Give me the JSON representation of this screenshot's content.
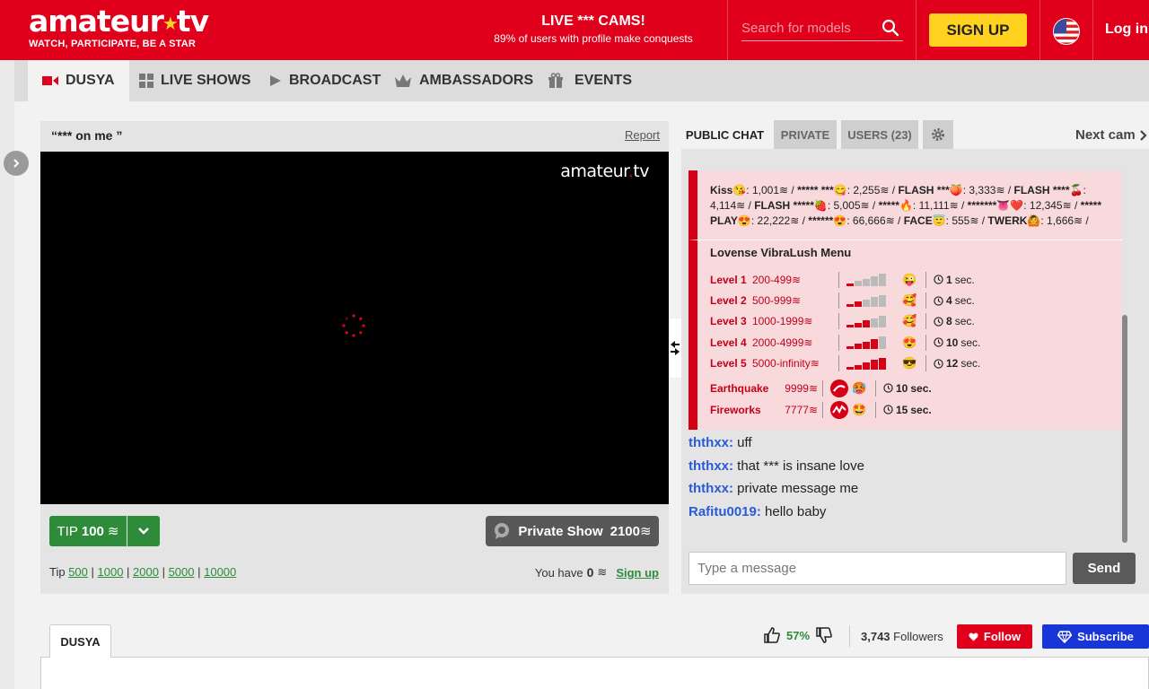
{
  "header": {
    "logo_word_left": "amateur",
    "logo_word_right": "tv",
    "tagline": "WATCH, PARTICIPATE, BE A STAR",
    "promo_title": "LIVE *** CAMS!",
    "promo_subtitle": "89% of users with profile make conquests",
    "search_placeholder": "Search for models",
    "signup_label": "SIGN UP",
    "login_label": "Log in",
    "brand_color": "#e0001b",
    "accent_color": "#ffd21f"
  },
  "nav": {
    "items": [
      {
        "label": "DUSYA",
        "icon": "camera-icon"
      },
      {
        "label": "LIVE SHOWS",
        "icon": "grid-icon"
      },
      {
        "label": "BROADCAST",
        "icon": "play-icon"
      },
      {
        "label": "AMBASSADORS",
        "icon": "crown-icon"
      },
      {
        "label": "EVENTS",
        "icon": "gift-icon"
      }
    ]
  },
  "player": {
    "title": "“*** on me ”",
    "report_label": "Report",
    "video_logo_left": "amateur",
    "video_logo_right": "tv",
    "tip_label": "TIP",
    "tip_amount": "100",
    "private_label": "Private Show",
    "private_price": "2100",
    "tip_prefix": "Tip",
    "tip_presets": [
      "500",
      "1000",
      "2000",
      "5000",
      "10000"
    ],
    "balance_label": "You have",
    "balance_value": "0",
    "balance_signup": "Sign up"
  },
  "chat": {
    "tabs": {
      "public": "PUBLIC CHAT",
      "private": "PRIVATE",
      "users": "USERS (23)"
    },
    "next_cam": "Next cam",
    "tip_menu": [
      {
        "name": "Kiss😘",
        "price": "1,001"
      },
      {
        "name": "***** ***😋",
        "price": "2,255"
      },
      {
        "name": "FLASH ***🍑",
        "price": "3,333"
      },
      {
        "name": "FLASH ****🍒",
        "price": "4,114"
      },
      {
        "name": "FLASH *****🍓",
        "price": "5,005"
      },
      {
        "name": "*****🔥",
        "price": "11,111"
      },
      {
        "name": "*******👅❤️",
        "price": "12,345"
      },
      {
        "name": "***** PLAY😍",
        "price": "22,222"
      },
      {
        "name": "******😍",
        "price": "66,666"
      },
      {
        "name": "FACE😇",
        "price": "555"
      },
      {
        "name": "TWERK🙆",
        "price": "1,666"
      }
    ],
    "lovense": {
      "title": "Lovense VibraLush Menu",
      "levels": [
        {
          "name": "Level 1",
          "range": "200-499",
          "bars": 1,
          "emoji": "😜",
          "time": "1",
          "unit": "sec."
        },
        {
          "name": "Level 2",
          "range": "500-999",
          "bars": 2,
          "emoji": "🥰",
          "time": "4",
          "unit": "sec."
        },
        {
          "name": "Level 3",
          "range": "1000-1999",
          "bars": 3,
          "emoji": "🥰",
          "time": "8",
          "unit": "sec."
        },
        {
          "name": "Level 4",
          "range": "2000-4999",
          "bars": 4,
          "emoji": "😍",
          "time": "10",
          "unit": "sec."
        },
        {
          "name": "Level 5",
          "range": "5000-infinity",
          "bars": 5,
          "emoji": "😎",
          "time": "12",
          "unit": "sec."
        }
      ],
      "effects": [
        {
          "name": "Earthquake",
          "cost": "9999",
          "emoji": "🥵",
          "time": "10",
          "unit": "sec."
        },
        {
          "name": "Fireworks",
          "cost": "7777",
          "emoji": "🤩",
          "time": "15",
          "unit": "sec."
        }
      ]
    },
    "messages": [
      {
        "user": "ththxx:",
        "text": "uff"
      },
      {
        "user": "ththxx:",
        "text": "that *** is insane love"
      },
      {
        "user": "ththxx:",
        "text": "private message me"
      },
      {
        "user": "Rafitu0019:",
        "text": "hello baby"
      }
    ],
    "input_placeholder": "Type a message",
    "send_label": "Send"
  },
  "profile": {
    "tab_label": "DUSYA",
    "rating_pct": "57%",
    "followers_count": "3,743",
    "followers_label": "Followers",
    "follow_label": "Follow",
    "subscribe_label": "Subscribe"
  }
}
